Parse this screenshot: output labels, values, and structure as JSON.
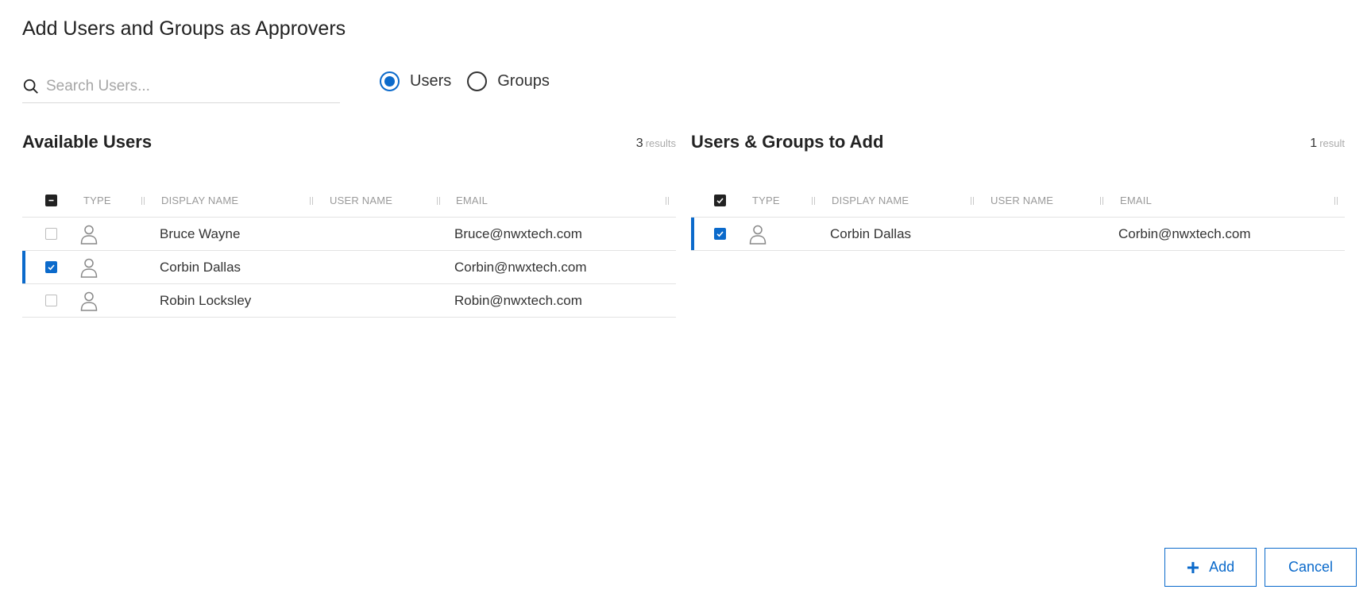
{
  "dialog": {
    "title": "Add Users and Groups as Approvers"
  },
  "search": {
    "placeholder": "Search Users...",
    "value": ""
  },
  "filter": {
    "options": [
      {
        "label": "Users",
        "checked": true
      },
      {
        "label": "Groups",
        "checked": false
      }
    ]
  },
  "available": {
    "title": "Available Users",
    "count": "3",
    "count_label": "results",
    "columns": [
      "TYPE",
      "DISPLAY NAME",
      "USER NAME",
      "EMAIL"
    ],
    "header_checkbox": "indeterminate",
    "rows": [
      {
        "display_name": "Bruce Wayne",
        "user_name": "",
        "email": "Bruce@nwxtech.com",
        "checked": false
      },
      {
        "display_name": "Corbin Dallas",
        "user_name": "",
        "email": "Corbin@nwxtech.com",
        "checked": true
      },
      {
        "display_name": "Robin Locksley",
        "user_name": "",
        "email": "Robin@nwxtech.com",
        "checked": false
      }
    ]
  },
  "to_add": {
    "title": "Users & Groups to Add",
    "count": "1",
    "count_label": "result",
    "columns": [
      "TYPE",
      "DISPLAY NAME",
      "USER NAME",
      "EMAIL"
    ],
    "header_checkbox": "checked",
    "rows": [
      {
        "display_name": "Corbin Dallas",
        "user_name": "",
        "email": "Corbin@nwxtech.com",
        "checked": true
      }
    ]
  },
  "buttons": {
    "add_label": "Add",
    "cancel_label": "Cancel"
  },
  "colors": {
    "accent": "#0b6acb",
    "text": "#333333",
    "muted": "#9a9a9a"
  }
}
